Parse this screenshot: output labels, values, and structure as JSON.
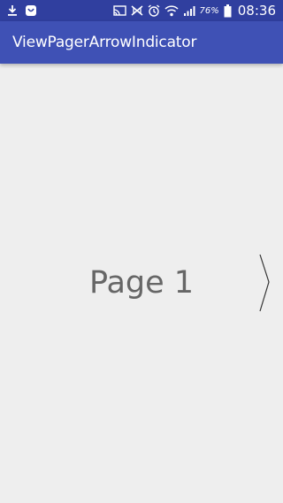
{
  "status_bar": {
    "left_icons": [
      "download-icon",
      "notification-app-icon"
    ],
    "right_icons": [
      "cast-icon",
      "nfc-icon",
      "alarm-icon",
      "wifi-icon",
      "signal-icon",
      "battery-icon"
    ],
    "battery_percent": "76%",
    "time": "08:36",
    "background_color": "#303f9f"
  },
  "app_bar": {
    "title": "ViewPagerArrowIndicator",
    "background_color": "#3f51b5"
  },
  "pager": {
    "page_label": "Page 1",
    "next_arrow_icon": "chevron-right-icon",
    "background_color": "#eeeeee"
  }
}
